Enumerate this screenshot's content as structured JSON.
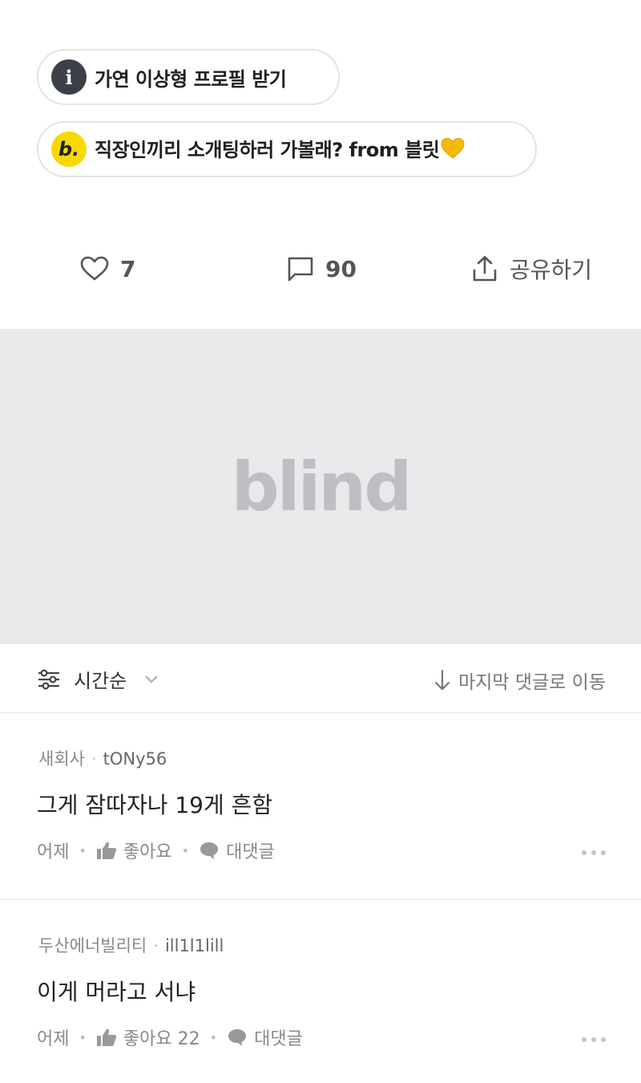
{
  "chips": [
    {
      "icon": "info-icon",
      "icon_glyph": "i",
      "label": "가연 이상형 프로필 받기"
    },
    {
      "icon": "blind-logo-icon",
      "icon_glyph": "b.",
      "label": "직장인끼리 소개팅하러 가볼래? from 블릿"
    }
  ],
  "actions": {
    "like_count": "7",
    "comment_count": "90",
    "share_label": "공유하기"
  },
  "banner": {
    "logo_text": "blind"
  },
  "sort": {
    "current": "시간순",
    "jump_label": "마지막 댓글로 이동"
  },
  "comments": [
    {
      "company": "새회사",
      "nickname": "tONy56",
      "body": "그게 잠따자나 19게 흔함",
      "time": "어제",
      "like_label": "좋아요",
      "reply_label": "대댓글"
    },
    {
      "company": "두산에너빌리티",
      "nickname": "ill1l1lill",
      "body": "이게 머라고 서냐",
      "time": "어제",
      "like_label": "좋아요 22",
      "reply_label": "대댓글"
    }
  ],
  "colors": {
    "banner_bg": "#e8e9eb",
    "blind_yellow": "#f7d900",
    "heart_yellow": "#f5b900"
  }
}
